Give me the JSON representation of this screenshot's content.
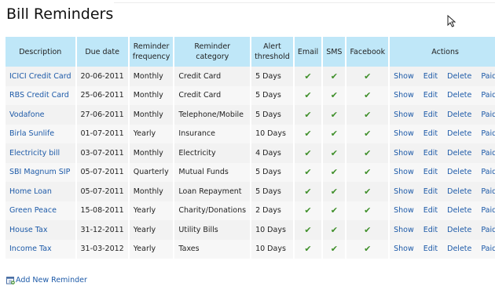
{
  "title": "Bill Reminders",
  "headers": {
    "description": "Description",
    "due_date": "Due date",
    "frequency_line1": "Reminder",
    "frequency_line2": "frequency",
    "category_line1": "Reminder",
    "category_line2": "category",
    "threshold_line1": "Alert",
    "threshold_line2": "threshold",
    "email": "Email",
    "sms": "SMS",
    "facebook": "Facebook",
    "actions": "Actions"
  },
  "action_labels": {
    "show": "Show",
    "edit": "Edit",
    "delete": "Delete",
    "paid": "Paid"
  },
  "check_glyph": "✔",
  "colors": {
    "header_bg": "#bfe7f8",
    "link": "#1d5aa8",
    "check": "#3f8f2a"
  },
  "rows": [
    {
      "description": "ICICI Credit Card",
      "due_date": "20-06-2011",
      "frequency": "Monthly",
      "category": "Credit Card",
      "threshold": "5 Days"
    },
    {
      "description": "RBS Credit Card",
      "due_date": "25-06-2011",
      "frequency": "Monthly",
      "category": "Credit Card",
      "threshold": "5 Days"
    },
    {
      "description": "Vodafone",
      "due_date": "27-06-2011",
      "frequency": "Monthly",
      "category": "Telephone/Mobile",
      "threshold": "5 Days"
    },
    {
      "description": "Birla Sunlife",
      "due_date": "01-07-2011",
      "frequency": "Yearly",
      "category": "Insurance",
      "threshold": "10 Days"
    },
    {
      "description": "Electricity bill",
      "due_date": "03-07-2011",
      "frequency": "Monthly",
      "category": "Electricity",
      "threshold": "4 Days"
    },
    {
      "description": "SBI Magnum SIP",
      "due_date": "05-07-2011",
      "frequency": "Quarterly",
      "category": "Mutual Funds",
      "threshold": "5 Days"
    },
    {
      "description": "Home Loan",
      "due_date": "05-07-2011",
      "frequency": "Monthly",
      "category": "Loan Repayment",
      "threshold": "5 Days"
    },
    {
      "description": "Green Peace",
      "due_date": "15-08-2011",
      "frequency": "Yearly",
      "category": "Charity/Donations",
      "threshold": "2 Days"
    },
    {
      "description": "House Tax",
      "due_date": "31-12-2011",
      "frequency": "Yearly",
      "category": "Utility Bills",
      "threshold": "10 Days"
    },
    {
      "description": "Income Tax",
      "due_date": "31-03-2012",
      "frequency": "Yearly",
      "category": "Taxes",
      "threshold": "10 Days"
    }
  ],
  "add_link": "Add New Reminder",
  "icons": {
    "add": "calendar-add-icon",
    "cursor": "mouse-pointer-icon",
    "check": "checkmark-icon"
  }
}
